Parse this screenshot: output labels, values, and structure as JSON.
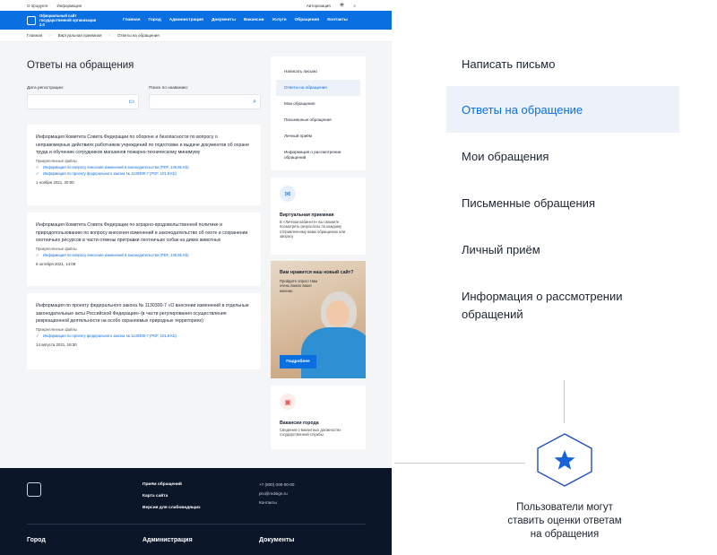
{
  "site": {
    "topbar": {
      "links": [
        "О продукте",
        "Информация"
      ],
      "login": "Авторизация"
    },
    "nav": {
      "logo_text": "Официальный сайт государственной организации 2.0",
      "items": [
        "Главная",
        "Город",
        "Администрация",
        "Документы",
        "Вакансии",
        "Услуги",
        "Обращения",
        "Контакты"
      ]
    },
    "breadcrumbs": [
      "Главная",
      "Виртуальная приемная",
      "Ответы на обращения"
    ],
    "page_title": "Ответы на обращения",
    "filters": {
      "date_label": "Дата регистрации:",
      "search_label": "Поиск по названию:"
    },
    "cards": [
      {
        "text": "Информация Комитета Совета Федерации по обороне и безопасности по вопросу о неправомерных действиях работников учреждений по подготовке и выдаче документов об охране труда и обучению сотрудников магазинов пожарно-техническому минимуму",
        "att_header": "Прикрепленные файлы",
        "attachments": [
          "Информация по вопросу внесения изменений в законодательство (PDF, 136.55 Kb)",
          "Информация по проекту федерального закона № 1130300-7 (PDF, 101.8 Kb)"
        ],
        "date": "1 ноября 2021, 20:00"
      },
      {
        "text": "Информация Комитета Совета Федерации по аграрно-продовольственной политике и природопользованию по вопросу внесения изменений в законодательство об охоте и сохранении охотничьих ресурсов в части отмены притравки охотничьих собак на диких животных",
        "att_header": "Прикрепленные файлы",
        "attachments": [
          "Информация по вопросу внесения изменений в законодательство (PDF, 136.55 Kb)"
        ],
        "date": "6 октября 2021, 14:08"
      },
      {
        "text": "Информация по проекту федерального закона № 1130300-7 «О внесении изменений в отдельные законодательные акты Российской Федерации» (в части регулирования осуществления рекреационной деятельности на особо охраняемых природных территориях)",
        "att_header": "Прикрепленные файлы",
        "attachments": [
          "Информация по проекту федерального закона № 1130300-7 (PDF, 101.8 Kb)"
        ],
        "date": "14 августа 2021, 16:30"
      }
    ],
    "side_menu": [
      "Написать письмо",
      "Ответы на обращения",
      "Мои обращения",
      "Письменные обращения",
      "Личный приём",
      "Информация о рассмотрении обращений"
    ],
    "virtual": {
      "title": "Виртуальная приемная",
      "text": "В «Личном кабинете» вы сможете посмотреть результаты по каждому отправленному вами обращению или запросу"
    },
    "promo": {
      "title": "Вам нравится наш новый сайт?",
      "text": "Пройдите опрос! Нам очень важно ваше мнение.",
      "button": "Подробнее"
    },
    "vacancies": {
      "title": "Вакансии города",
      "text": "Сведения о вакантных должностях государственной службы"
    },
    "footer": {
      "links": [
        "Приём обращений",
        "Карта сайта",
        "Версия для слабовидящих"
      ],
      "contacts": [
        "+7 (800) 000-00-00",
        "pro@redsign.ru",
        "Контакты"
      ],
      "sections": [
        "Город",
        "Администрация",
        "Документы"
      ]
    }
  },
  "zoom_menu": {
    "items": [
      "Написать письмо",
      "Ответы на обращение",
      "Мои обращения",
      "Письменные обращения",
      "Личный приём",
      "Информация о рассмотрении обращений"
    ],
    "active_index": 1
  },
  "callout": {
    "icon": "star-icon",
    "text_lines": [
      "Пользователи могут",
      "ставить оценки ответам",
      "на обращения"
    ]
  },
  "colors": {
    "accent": "#0a6fe0",
    "footer": "#0b1628",
    "active_bg": "#edf1f9"
  }
}
